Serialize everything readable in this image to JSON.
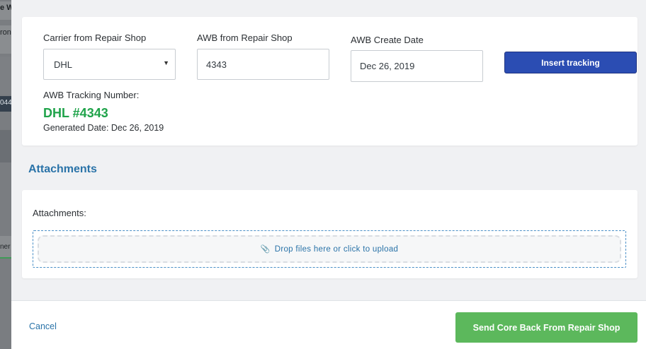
{
  "background": {
    "fragments": [
      "e W",
      "ron",
      "044",
      "ner"
    ]
  },
  "tracking": {
    "carrier_label": "Carrier from Repair Shop",
    "carrier_value": "DHL",
    "awb_label": "AWB from Repair Shop",
    "awb_value": "4343",
    "create_date_label": "AWB Create Date",
    "create_date_value": "Dec 26, 2019",
    "insert_button": "Insert tracking",
    "awb_tracking_label": "AWB Tracking Number:",
    "awb_tracking_value": "DHL #4343",
    "generated_date": "Generated Date: Dec 26, 2019"
  },
  "attachments": {
    "section_title": "Attachments",
    "field_label": "Attachments:",
    "dropzone_text": "Drop files here or click to upload",
    "dropzone_icon": "paperclip-icon"
  },
  "footer": {
    "cancel_label": "Cancel",
    "send_label": "Send Core Back From Repair Shop"
  },
  "colors": {
    "primary_button": "#2b4db3",
    "success_button": "#5cb85c",
    "tracking_value": "#1fa34a",
    "link": "#2a73a8"
  }
}
